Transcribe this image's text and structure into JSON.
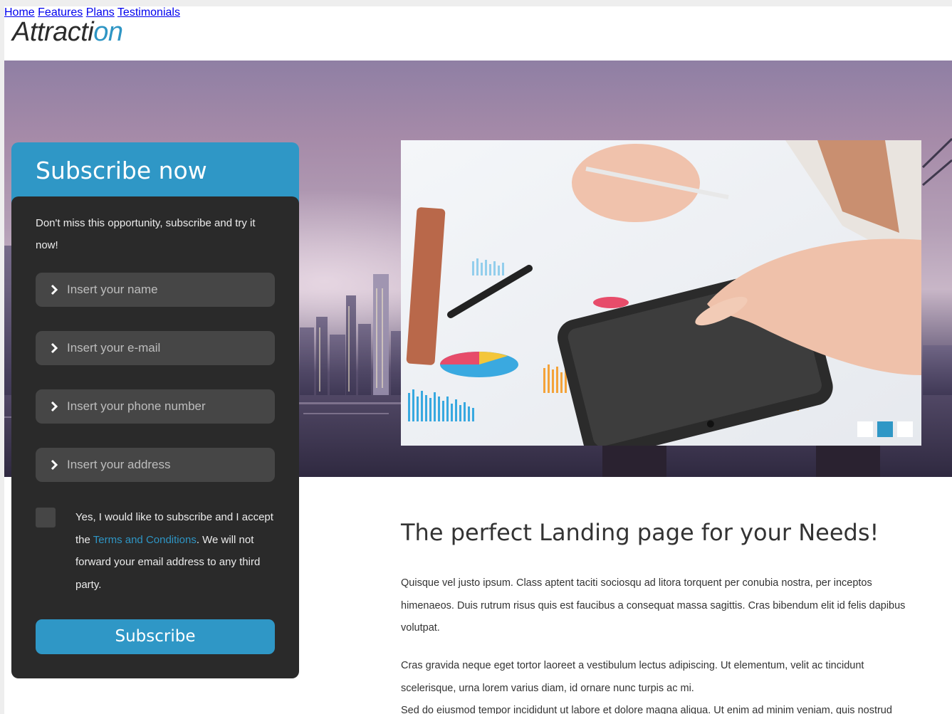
{
  "header": {
    "logo_main": "Attracti",
    "logo_accent": "on",
    "nav": [
      "Home",
      "Features",
      "Plans",
      "Testimonials"
    ]
  },
  "form": {
    "title": "Subscribe now",
    "intro": "Don't miss this opportunity, subscribe and try it now!",
    "fields": [
      {
        "placeholder": "Insert your name"
      },
      {
        "placeholder": "Insert your e-mail"
      },
      {
        "placeholder": "Insert your phone number"
      },
      {
        "placeholder": "Insert your address"
      }
    ],
    "consent_pre": "Yes, I would like to subscribe and I accept the ",
    "consent_link": "Terms and Conditions",
    "consent_post": ". We will not forward your email address to any third party.",
    "submit_label": "Subscribe"
  },
  "slider": {
    "active_dot": 2,
    "dot_count": 3
  },
  "content": {
    "headline": "The perfect Landing page for your Needs!",
    "paragraphs": [
      "Quisque vel justo ipsum. Class aptent taciti sociosqu ad litora torquent per conubia nostra, per inceptos himenaeos. Duis rutrum risus quis est faucibus a consequat massa sagittis. Cras bibendum elit id felis dapibus volutpat.",
      "Cras gravida neque eget tortor laoreet a vestibulum lectus adipiscing. Ut elementum, velit ac tincidunt scelerisque, urna lorem varius diam, id ornare nunc turpis ac mi.",
      "Sed do eiusmod tempor incididunt ut labore et dolore magna aliqua. Ut enim ad minim veniam, quis nostrud"
    ]
  },
  "colors": {
    "accent": "#2f97c6",
    "card_bg": "#2a2a2a",
    "field_bg": "#464646"
  }
}
